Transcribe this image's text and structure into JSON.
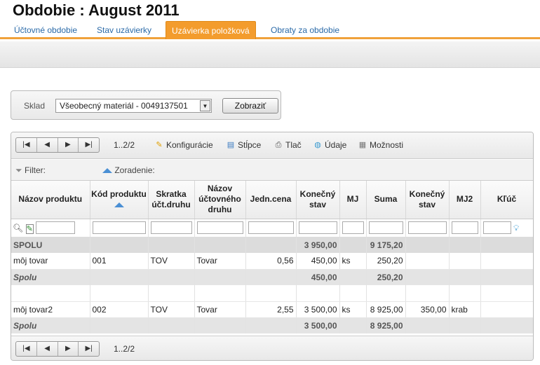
{
  "page": {
    "title": "Obdobie :  August 2011"
  },
  "tabs": [
    {
      "label": "Účtovné obdobie"
    },
    {
      "label": "Stav uzávierky"
    },
    {
      "label": "Uzávierka položková"
    },
    {
      "label": "Obraty za obdobie"
    }
  ],
  "warehouse": {
    "label": "Sklad",
    "selected": "Všeobecný materiál - 0049137501",
    "button": "Zobraziť"
  },
  "toolbar": {
    "page_info": "1..2/2",
    "config": "Konfigurácie",
    "columns": "Stĺpce",
    "print": "Tlač",
    "data": "Údaje",
    "options": "Možnosti"
  },
  "filterbar": {
    "filter": "Filter:",
    "sort": "Zoradenie:"
  },
  "table": {
    "headers": [
      "Názov produktu",
      "Kód produktu",
      "Skratka účt.druhu",
      "Názov účtovného druhu",
      "Jedn.cena",
      "Konečný stav",
      "MJ",
      "Suma",
      "Konečný stav",
      "MJ2",
      "Kľúč"
    ],
    "grand_total": {
      "label": "SPOLU",
      "konecny_stav": "3 950,00",
      "suma": "9 175,20"
    },
    "rows": [
      {
        "nazov": "môj tovar",
        "kod": "001",
        "skratka": "TOV",
        "druh": "Tovar",
        "cena": "0,56",
        "stav": "450,00",
        "mj": "ks",
        "suma": "250,20",
        "stav2": "",
        "mj2": "",
        "kluc": ""
      },
      {
        "nazov": "môj tovar2",
        "kod": "002",
        "skratka": "TOV",
        "druh": "Tovar",
        "cena": "2,55",
        "stav": "3 500,00",
        "mj": "ks",
        "suma": "8 925,00",
        "stav2": "350,00",
        "mj2": "krab",
        "kluc": ""
      }
    ],
    "subtotals": [
      {
        "label": "Spolu",
        "stav": "450,00",
        "suma": "250,20"
      },
      {
        "label": "Spolu",
        "stav": "3 500,00",
        "suma": "8 925,00"
      }
    ]
  },
  "bottombar": {
    "page_info": "1..2/2"
  }
}
